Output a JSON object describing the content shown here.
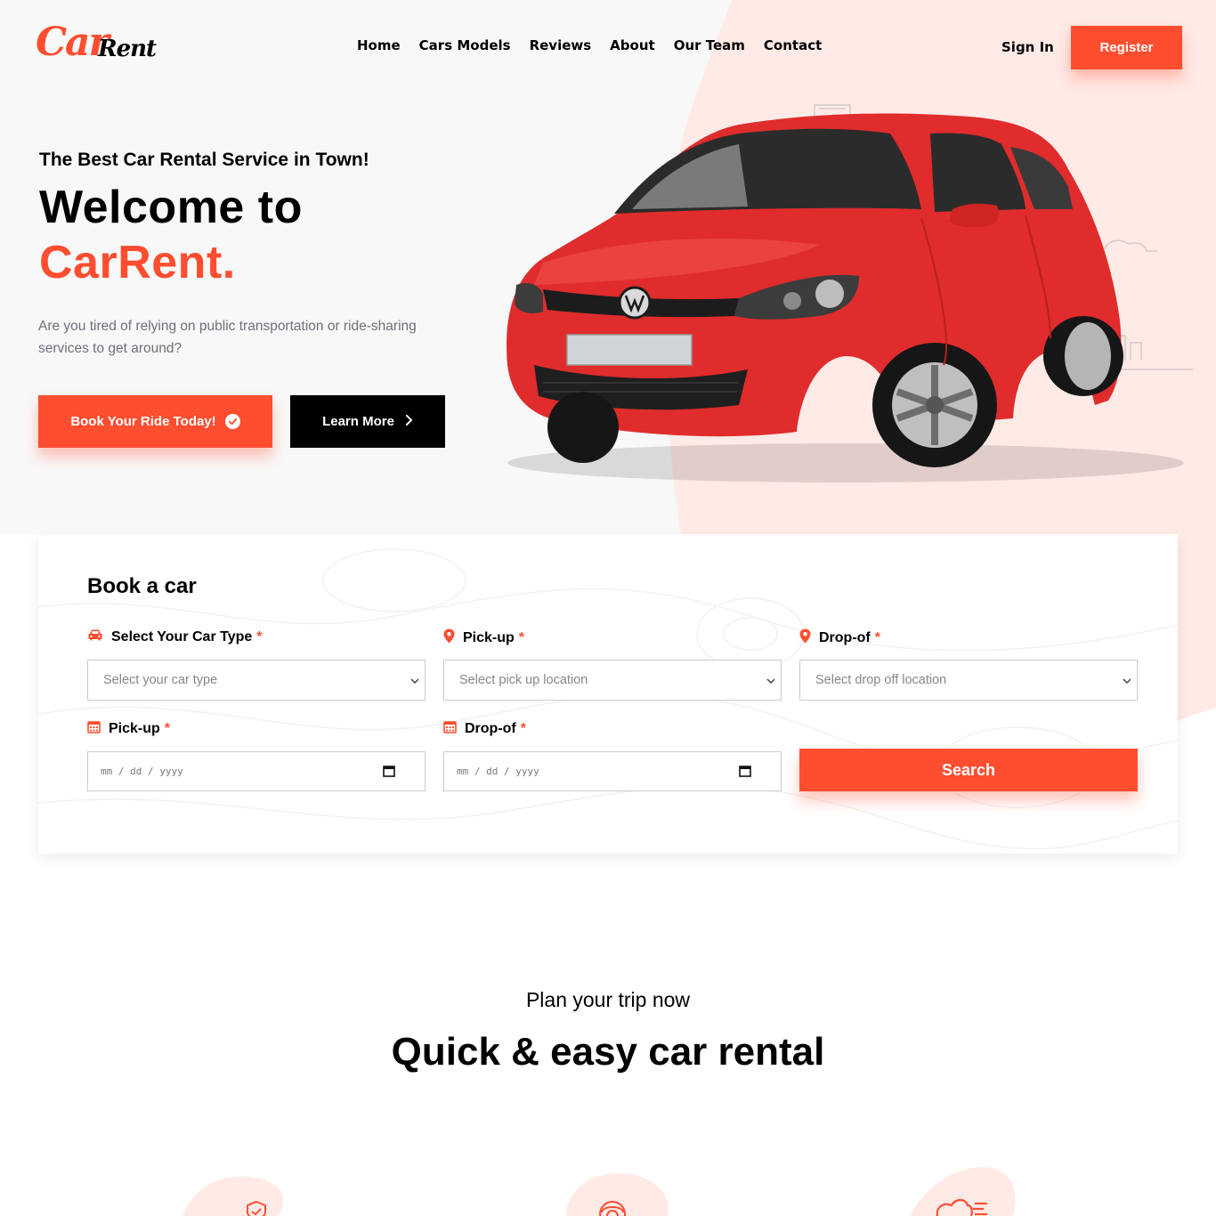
{
  "brand": {
    "logo_main": "Car",
    "logo_accent": "Rent"
  },
  "nav": {
    "links": [
      "Home",
      "Cars Models",
      "Reviews",
      "About",
      "Our Team",
      "Contact"
    ],
    "sign_in": "Sign In",
    "register": "Register"
  },
  "hero": {
    "subtitle": "The Best Car Rental Service in Town!",
    "title_line1": "Welcome to",
    "title_line2": "CarRent.",
    "description": "Are you tired of relying on public transportation or ride-sharing services to get around?",
    "book_button": "Book Your Ride Today!",
    "learn_button": "Learn More",
    "car_image": "red-hatchback-car"
  },
  "booking": {
    "title": "Book a car",
    "car_type": {
      "label": "Select Your Car Type",
      "required_mark": "*",
      "placeholder": "Select your car type",
      "icon": "car-icon"
    },
    "pick_up_location": {
      "label": "Pick-up",
      "required_mark": "*",
      "placeholder": "Select pick up location",
      "icon": "location-pin-icon"
    },
    "drop_off_location": {
      "label": "Drop-of",
      "required_mark": "*",
      "placeholder": "Select drop off location",
      "icon": "location-pin-icon"
    },
    "pick_up_date": {
      "label": "Pick-up",
      "required_mark": "*",
      "placeholder": "mm / dd / yyyy",
      "icon": "calendar-icon"
    },
    "drop_off_date": {
      "label": "Drop-of",
      "required_mark": "*",
      "placeholder": "mm / dd / yyyy",
      "icon": "calendar-icon"
    },
    "search_button": "Search"
  },
  "plan": {
    "subtitle": "Plan your trip now",
    "title": "Quick & easy car rental"
  },
  "colors": {
    "accent": "#ff4d30",
    "dark": "#010103",
    "muted": "#706f7b",
    "blob": "#ffeae6"
  }
}
